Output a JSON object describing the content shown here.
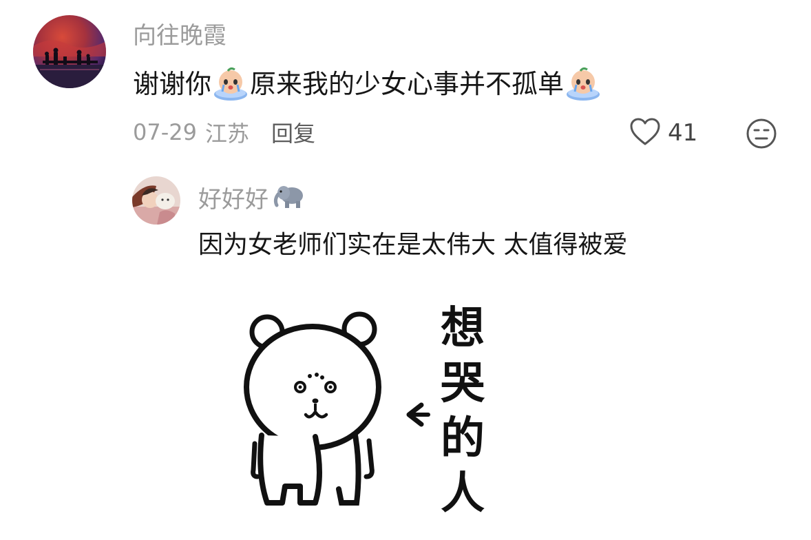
{
  "comment": {
    "username": "向往晚霞",
    "text_part1": "谢谢你",
    "text_part2": "原来我的少女心事并不孤单",
    "emoji": "crying-face-emoji",
    "date": "07-29",
    "location": "江苏",
    "reply_label": "回复",
    "like_count": "41",
    "like_icon": "heart-outline-icon",
    "dislike_icon": "meh-face-icon"
  },
  "reply": {
    "username": "好好好",
    "username_badge": "elephant-emoji",
    "text": "因为女老师们实在是太伟大 太值得被爱",
    "sticker": {
      "description_icon": "bear-sticker",
      "chars": [
        "想",
        "哭",
        "的",
        "人"
      ]
    }
  },
  "colors": {
    "username": "#9b9b9b",
    "body_text": "#161616",
    "meta_text": "#9b9b9b",
    "reply_link": "#5c5c5c",
    "background": "#ffffff"
  }
}
